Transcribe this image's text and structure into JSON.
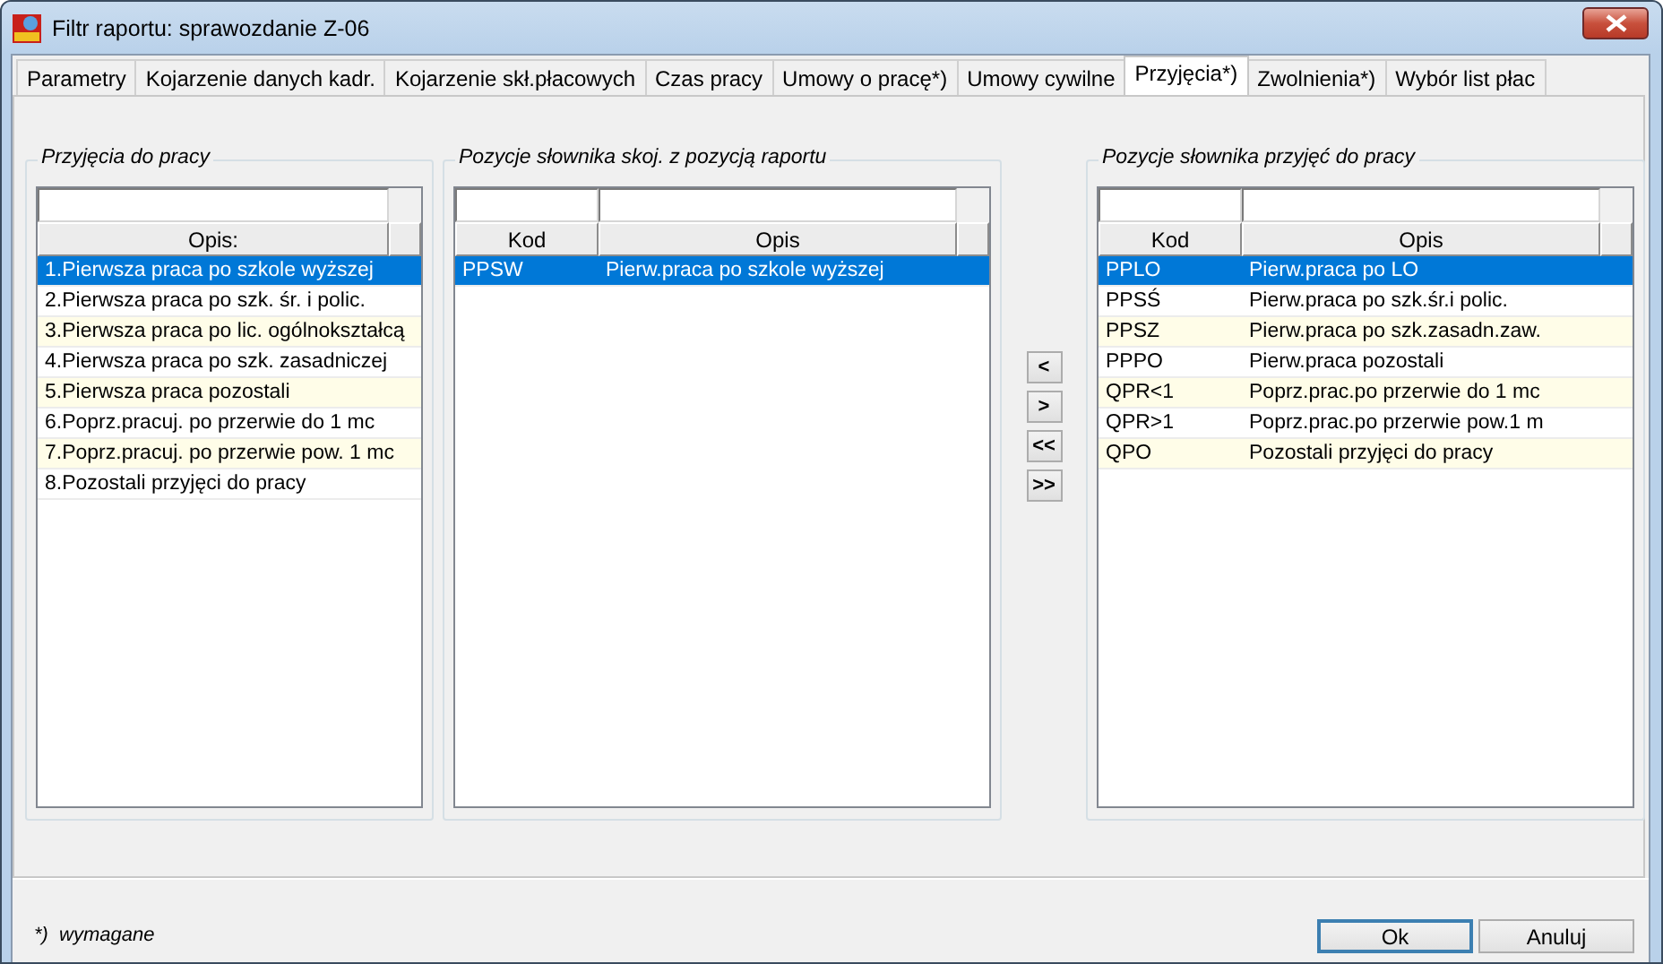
{
  "window": {
    "title": "Filtr raportu: sprawozdanie Z-06"
  },
  "tabs": [
    {
      "label": "Parametry",
      "selected": false
    },
    {
      "label": "Kojarzenie danych kadr.",
      "selected": false
    },
    {
      "label": "Kojarzenie skł.płacowych",
      "selected": false
    },
    {
      "label": "Czas pracy",
      "selected": false
    },
    {
      "label": "Umowy o pracę*)",
      "selected": false
    },
    {
      "label": "Umowy cywilne",
      "selected": false
    },
    {
      "label": "Przyjęcia*)",
      "selected": true
    },
    {
      "label": "Zwolnienia*)",
      "selected": false
    },
    {
      "label": "Wybór list płac",
      "selected": false
    }
  ],
  "panels": [
    {
      "title": "Przyjęcia do pracy",
      "columns": [
        "Opis:"
      ],
      "rows": [
        {
          "cells": [
            "1.Pierwsza praca po szkole wyższej"
          ],
          "selected": true
        },
        {
          "cells": [
            "2.Pierwsza praca po szk. śr. i polic."
          ],
          "selected": false
        },
        {
          "cells": [
            "3.Pierwsza praca po lic. ogólnokształcą"
          ],
          "selected": false
        },
        {
          "cells": [
            "4.Pierwsza praca po szk. zasadniczej"
          ],
          "selected": false
        },
        {
          "cells": [
            "5.Pierwsza praca pozostali"
          ],
          "selected": false
        },
        {
          "cells": [
            "6.Poprz.pracuj. po przerwie do 1 mc"
          ],
          "selected": false
        },
        {
          "cells": [
            "7.Poprz.pracuj. po przerwie pow. 1 mc"
          ],
          "selected": false
        },
        {
          "cells": [
            "8.Pozostali przyjęci do pracy"
          ],
          "selected": false
        }
      ]
    },
    {
      "title": "Pozycje słownika skoj. z pozycją raportu",
      "columns": [
        "Kod",
        "Opis"
      ],
      "rows": [
        {
          "cells": [
            "PPSW",
            "Pierw.praca po szkole wyższej"
          ],
          "selected": true
        }
      ]
    },
    {
      "title": "Pozycje słownika przyjęć do pracy",
      "columns": [
        "Kod",
        "Opis"
      ],
      "rows": [
        {
          "cells": [
            "PPLO",
            "Pierw.praca po LO"
          ],
          "selected": true
        },
        {
          "cells": [
            "PPSŚ",
            "Pierw.praca po szk.śr.i polic."
          ],
          "selected": false
        },
        {
          "cells": [
            "PPSZ",
            "Pierw.praca po szk.zasadn.zaw."
          ],
          "selected": false
        },
        {
          "cells": [
            "PPPO",
            "Pierw.praca pozostali"
          ],
          "selected": false
        },
        {
          "cells": [
            "QPR<1",
            "Poprz.prac.po przerwie do 1 mc"
          ],
          "selected": false
        },
        {
          "cells": [
            "QPR>1",
            "Poprz.prac.po przerwie pow.1 m"
          ],
          "selected": false
        },
        {
          "cells": [
            "QPO",
            "Pozostali przyjęci do pracy"
          ],
          "selected": false
        }
      ]
    }
  ],
  "transfer_buttons": [
    "<",
    ">",
    "<<",
    ">>"
  ],
  "footnote": "*)  wymagane",
  "buttons": [
    {
      "label": "Ok",
      "default": true
    },
    {
      "label": "Anuluj",
      "default": false
    }
  ]
}
